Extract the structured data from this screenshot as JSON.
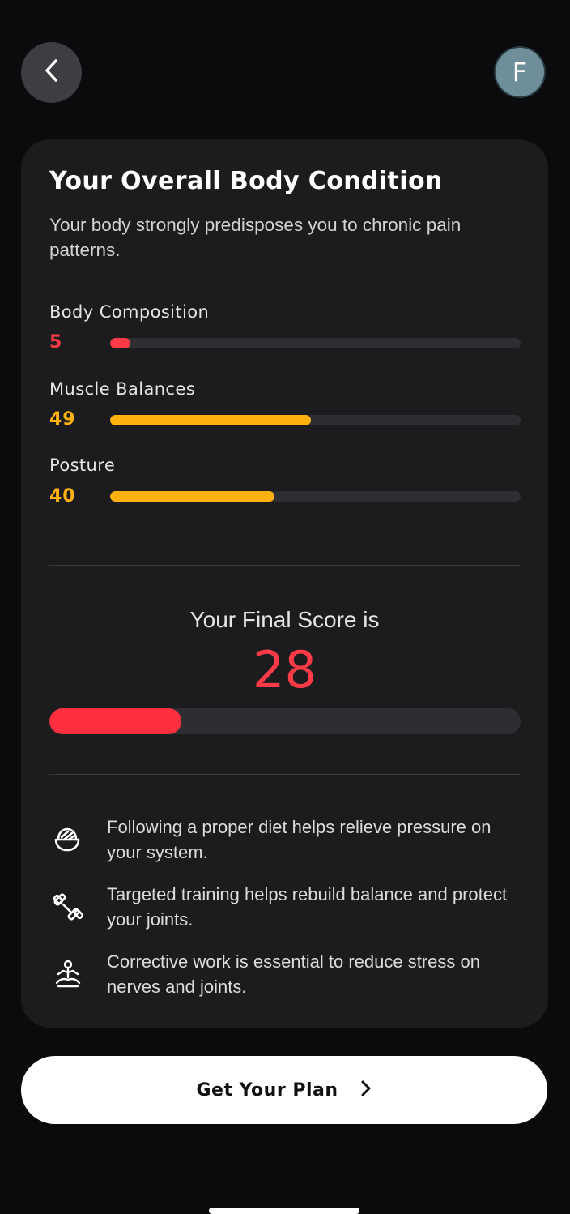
{
  "header": {
    "back_icon": "chevron-left-icon",
    "avatar_initial": "F"
  },
  "card": {
    "title": "Your Overall Body Condition",
    "subtitle": "Your body strongly predisposes you to chronic pain patterns.",
    "metrics": [
      {
        "label": "Body Composition",
        "value": "5",
        "progress": 0.05,
        "color": "#ff3b47"
      },
      {
        "label": "Muscle Balances",
        "value": "49",
        "progress": 0.49,
        "color": "#ffb20f"
      },
      {
        "label": "Posture",
        "value": "40",
        "progress": 0.4,
        "color": "#ffb20f"
      }
    ],
    "final": {
      "label": "Your Final Score is",
      "score": "28",
      "progress": 0.28,
      "color": "#ff2f40"
    },
    "tips": [
      {
        "icon": "food-bowl-icon",
        "text": "Following a proper diet helps relieve pressure on your system."
      },
      {
        "icon": "dumbbell-icon",
        "text": "Targeted training helps rebuild balance and protect your joints."
      },
      {
        "icon": "meditation-icon",
        "text": "Corrective work is essential to reduce stress on nerves and joints."
      }
    ]
  },
  "cta": {
    "label": "Get Your Plan",
    "icon": "chevron-right-icon"
  }
}
